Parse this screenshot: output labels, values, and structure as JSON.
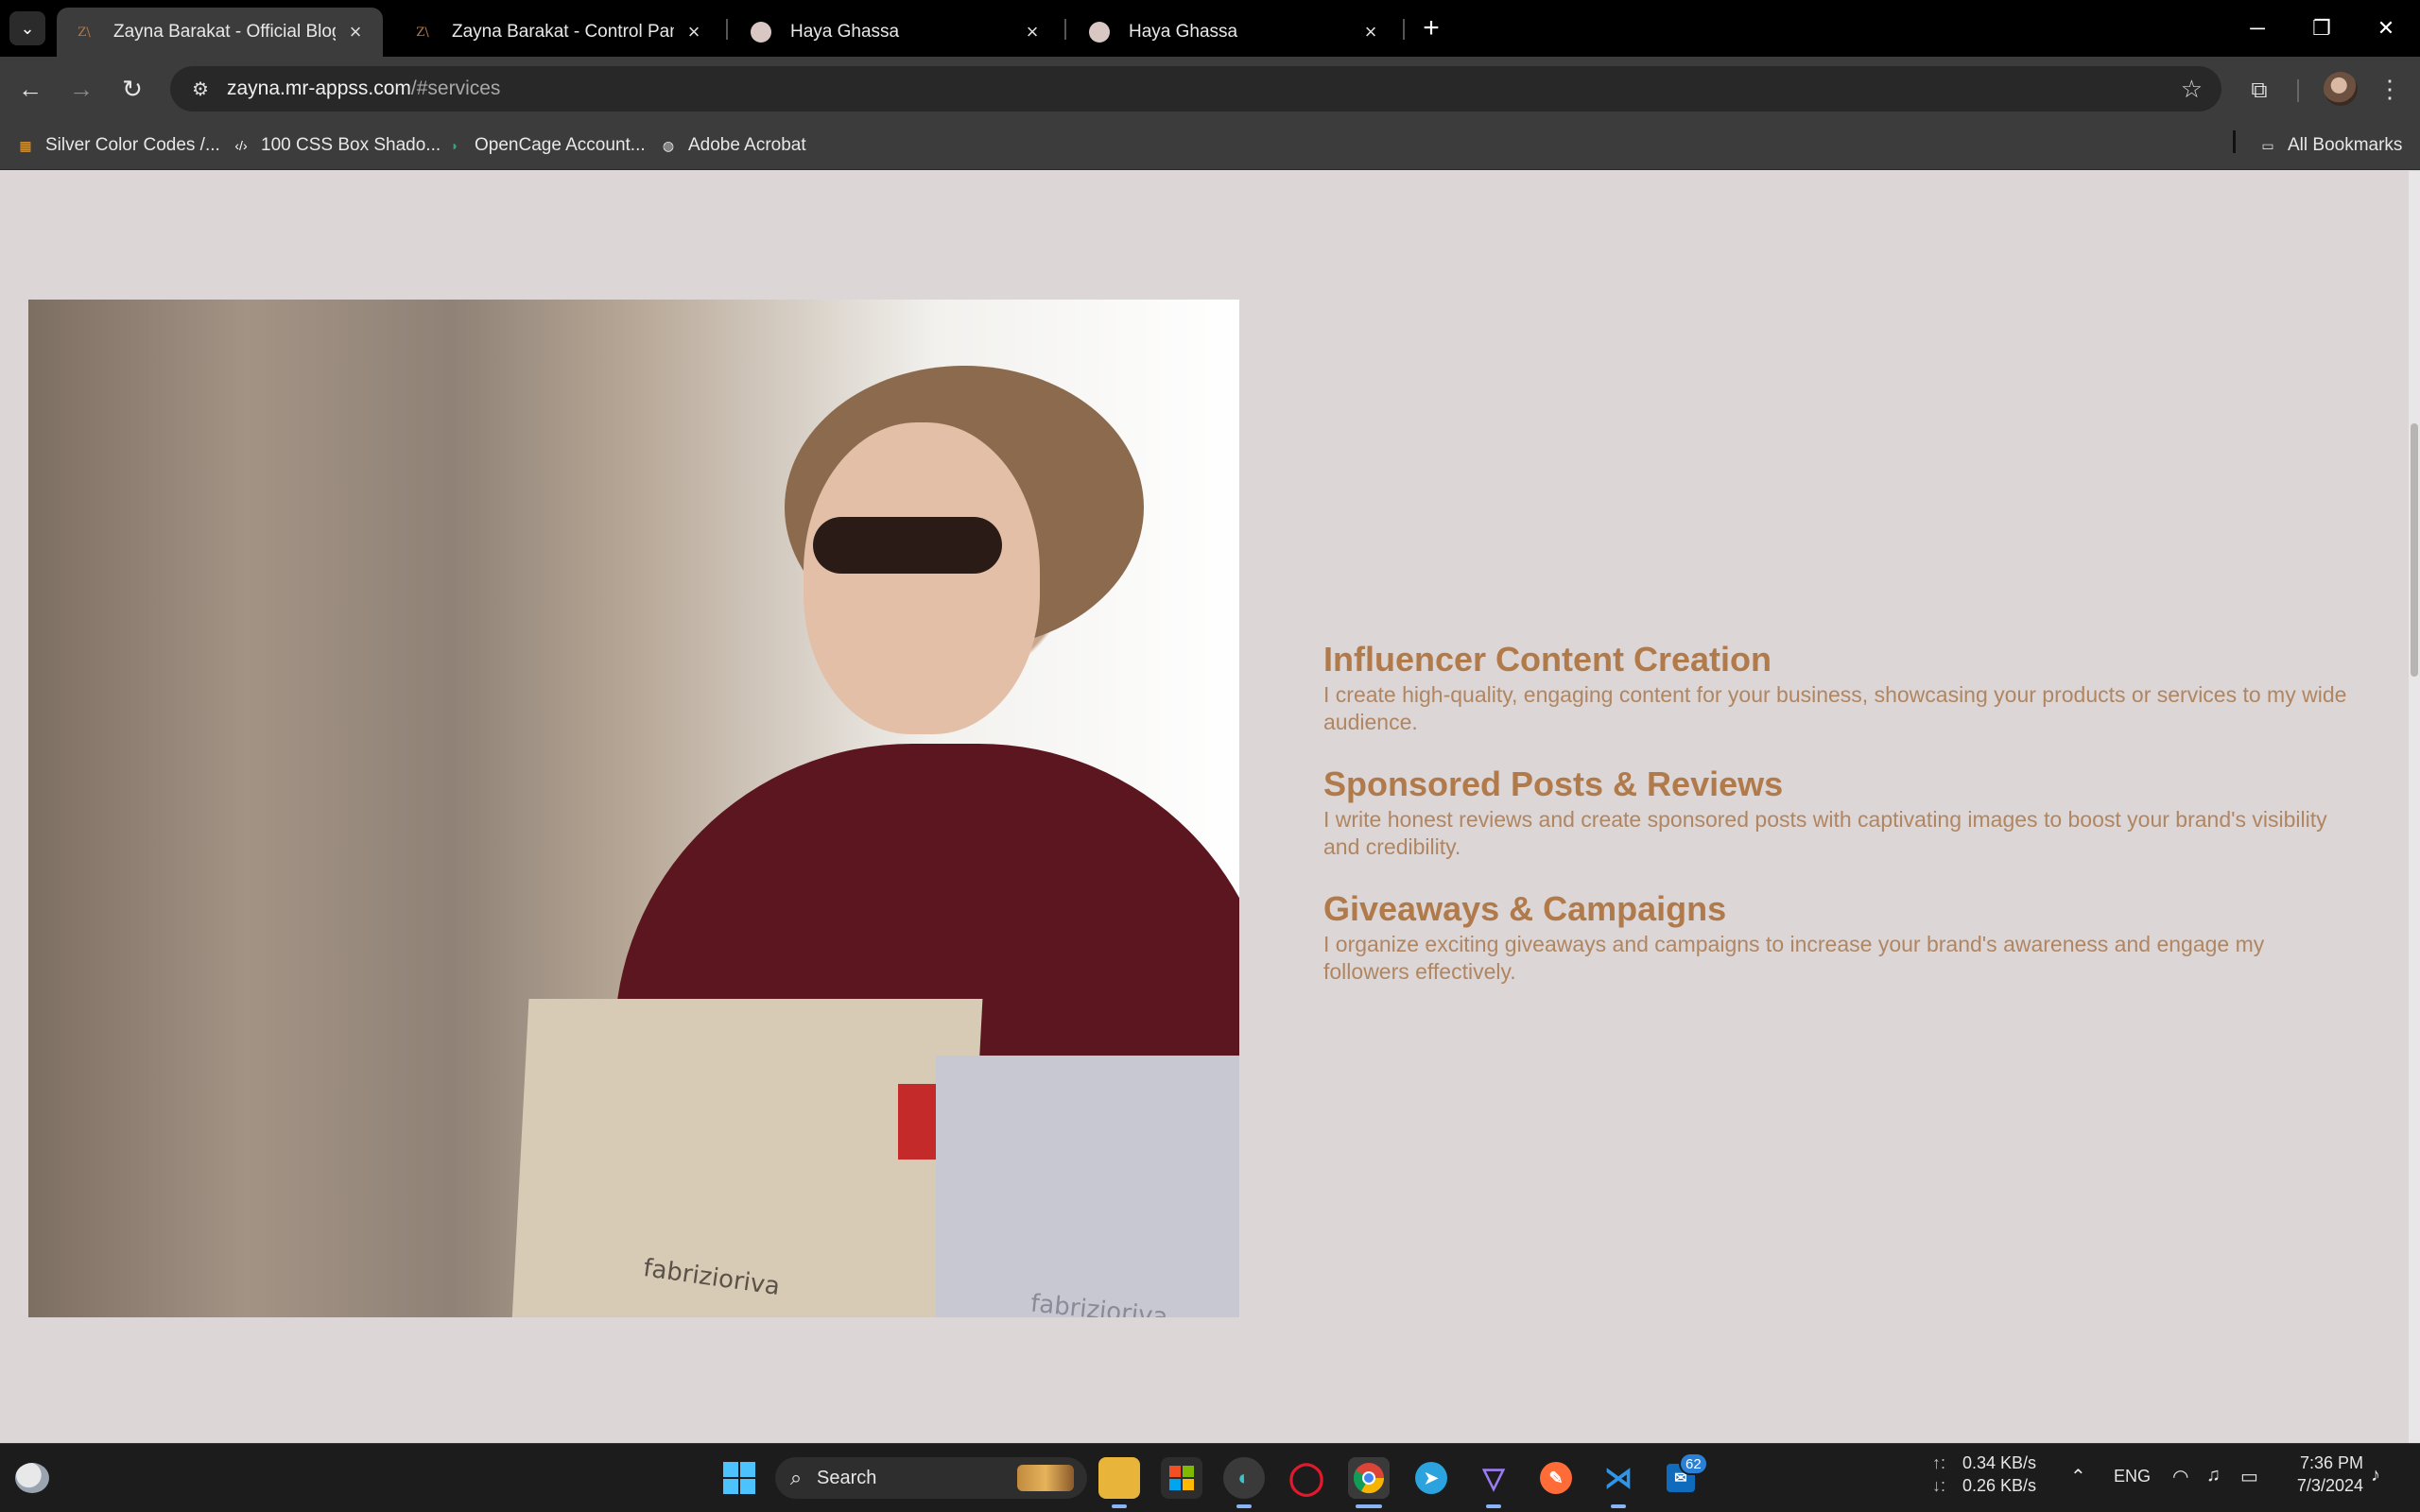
{
  "browser": {
    "tabs": [
      {
        "title": "Zayna Barakat - Official Blogger",
        "favicon": "zb-logo-icon",
        "active": true
      },
      {
        "title": "Zayna Barakat - Control Panel",
        "favicon": "zb-logo-icon",
        "active": false
      },
      {
        "title": "Haya Ghassa",
        "favicon": "circle-logo-icon",
        "active": false
      },
      {
        "title": "Haya Ghassa",
        "favicon": "circle-logo-icon",
        "active": false
      }
    ],
    "favicon_text": "Z\\",
    "url_host": "zayna.mr-appss.com",
    "url_path": "/#services",
    "bookmarks": [
      {
        "label": "Silver Color Codes /..."
      },
      {
        "label": "100 CSS Box Shado..."
      },
      {
        "label": "OpenCage Account..."
      },
      {
        "label": "Adobe Acrobat"
      }
    ],
    "all_bookmarks": "All Bookmarks"
  },
  "page": {
    "hero_image": {
      "bag_text_1": "fabrizioriva",
      "bag_text_2": "fabrizioriva"
    },
    "services": [
      {
        "title": "Influencer Content Creation",
        "description": "I create high-quality, engaging content for your business, showcasing your products or services to my wide audience."
      },
      {
        "title": "Sponsored Posts & Reviews",
        "description": "I write honest reviews and create sponsored posts with captivating images to boost your brand's visibility and credibility."
      },
      {
        "title": "Giveaways & Campaigns",
        "description": "I organize exciting giveaways and campaigns to increase your brand's awareness and engage my followers effectively."
      }
    ],
    "colors": {
      "background": "#dcd6d6",
      "heading": "#b07a4a",
      "text": "#b08662"
    }
  },
  "taskbar": {
    "search_label": "Search",
    "badge_count": "62",
    "net_up": "0.34 KB/s",
    "net_down": "0.26 KB/s",
    "net_up_arrow": "↑:",
    "net_down_arrow": "↓:",
    "language": "ENG",
    "time": "7:36 PM",
    "date": "7/3/2024"
  }
}
